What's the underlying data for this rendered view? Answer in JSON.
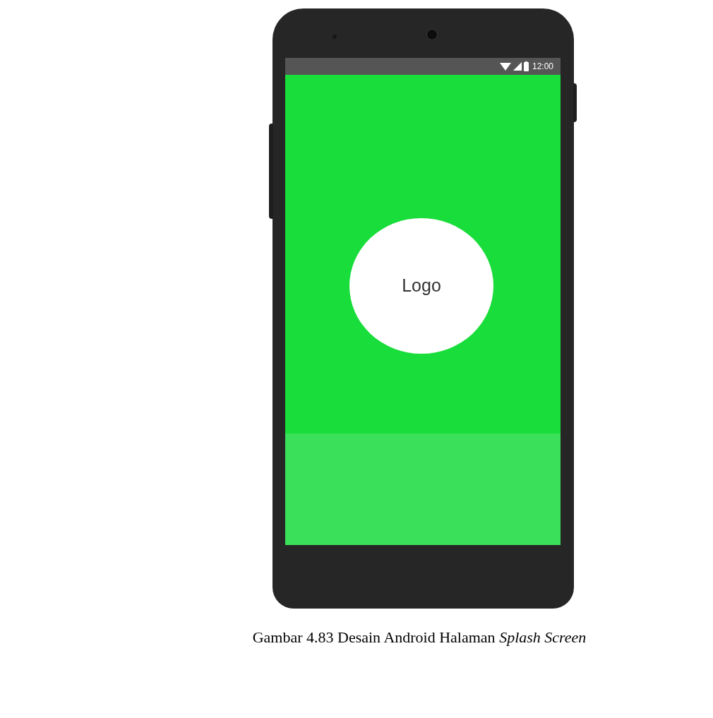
{
  "phone": {
    "status_bar": {
      "time": "12:00"
    },
    "splash": {
      "logo": "Logo"
    }
  },
  "caption": "Gambar 4.83 Desain Android Halaman *Splash Screen*"
}
